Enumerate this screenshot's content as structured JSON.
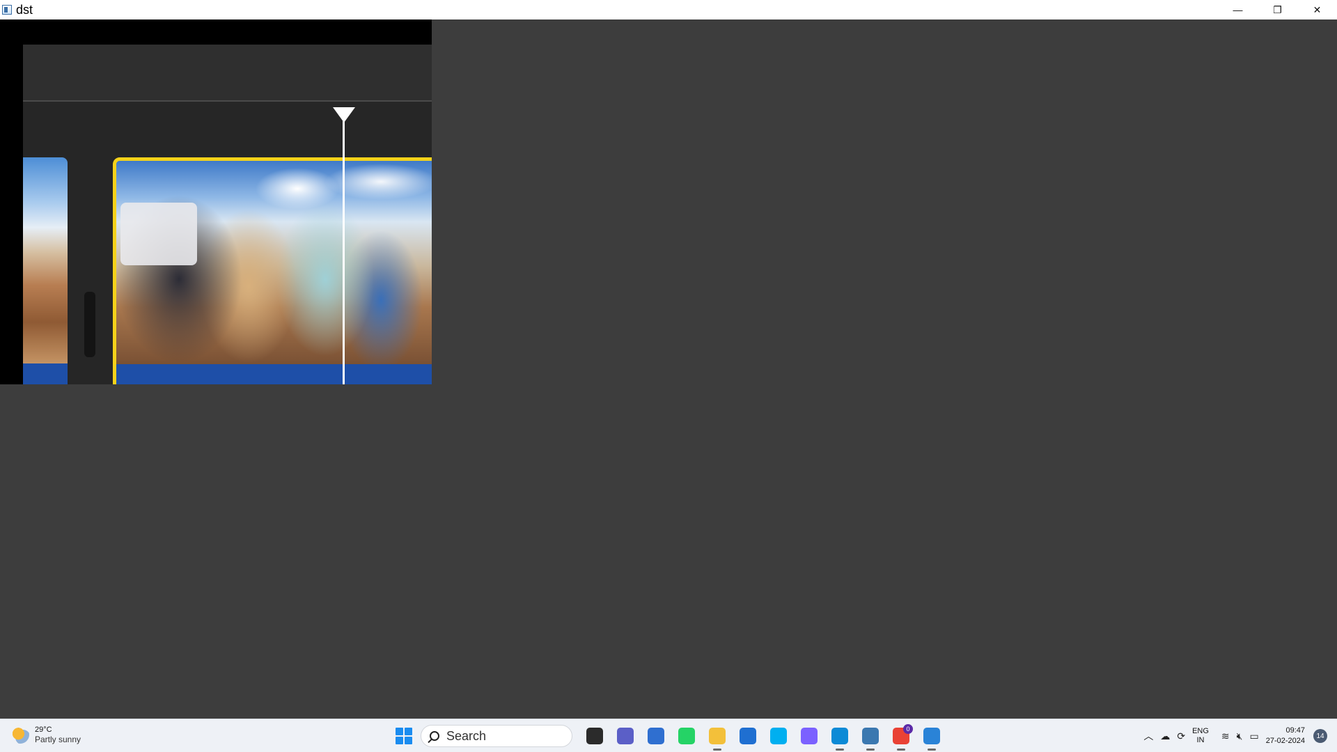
{
  "window": {
    "title": "dst",
    "controls": {
      "minimize": "—",
      "restore": "❐",
      "close": "✕"
    }
  },
  "editor": {
    "clips": [
      {
        "name": "left-clip",
        "selected": false
      },
      {
        "name": "main-clip",
        "selected": true
      }
    ],
    "selection_color": "#f5d21a",
    "audio_track_color": "#1e4fa8"
  },
  "taskbar": {
    "weather": {
      "temp": "29°C",
      "condition": "Partly sunny",
      "icon": "partly-sunny-icon"
    },
    "search": {
      "placeholder": "Search"
    },
    "apps": [
      {
        "name": "task-view-icon",
        "color": "#2b2b2b"
      },
      {
        "name": "teams-chat-icon",
        "color": "#5b5fc7"
      },
      {
        "name": "widgets-icon",
        "color": "#2f6fd0"
      },
      {
        "name": "whatsapp-icon",
        "color": "#25d366"
      },
      {
        "name": "file-explorer-icon",
        "color": "#f3c03a"
      },
      {
        "name": "microsoft-store-icon",
        "color": "#1f6fd1"
      },
      {
        "name": "skype-icon",
        "color": "#00aff0"
      },
      {
        "name": "copilot-icon",
        "color": "#7b61ff"
      },
      {
        "name": "edge-icon",
        "color": "#0c8ad6"
      },
      {
        "name": "python-app-icon",
        "color": "#3b78b0"
      },
      {
        "name": "chrome-icon",
        "color": "#e94235",
        "badge": "0"
      },
      {
        "name": "photos-icon",
        "color": "#2a83d7"
      }
    ],
    "tray": {
      "lang_line1": "ENG",
      "lang_line2": "IN",
      "time": "09:47",
      "date": "27-02-2024",
      "notifications": "14"
    }
  }
}
